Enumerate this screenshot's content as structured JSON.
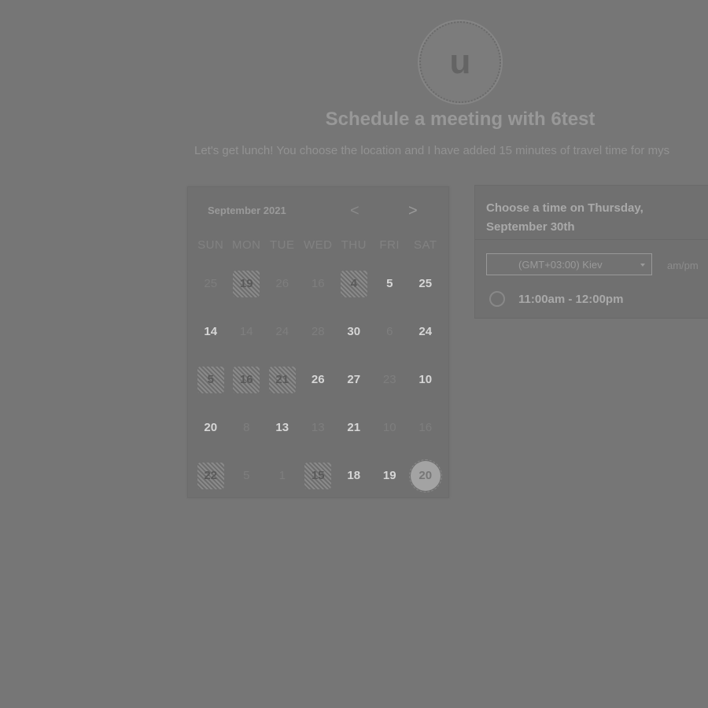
{
  "avatar": {
    "initial": "u"
  },
  "header": {
    "title": "Schedule a meeting with 6test",
    "subtitle": "Let's get lunch! You choose the location and I have added 15 minutes of travel time for mys"
  },
  "calendar": {
    "month_label": "September 2021",
    "prev_glyph": "<",
    "next_glyph": ">",
    "weekdays": [
      "SUN",
      "MON",
      "TUE",
      "WED",
      "THU",
      "FRI",
      "SAT"
    ],
    "weeks": [
      [
        "25",
        "19",
        "26",
        "16",
        "4",
        "5",
        "25"
      ],
      [
        "14",
        "14",
        "24",
        "28",
        "30",
        "6",
        "24"
      ],
      [
        "5",
        "16",
        "21",
        "26",
        "27",
        "23",
        "10"
      ],
      [
        "20",
        "8",
        "13",
        "13",
        "21",
        "10",
        "16"
      ],
      [
        "22",
        "5",
        "1",
        "15",
        "18",
        "19",
        "20"
      ]
    ]
  },
  "times": {
    "heading": "Choose a time on Thursday, September 30th",
    "timezone": "(GMT+03:00) Kiev",
    "ampm_label": "am/pm",
    "slots": [
      {
        "label": "11:00am - 12:00pm"
      }
    ]
  },
  "colors": {
    "background": "#767676",
    "selected_day": "#a3a3a3"
  }
}
